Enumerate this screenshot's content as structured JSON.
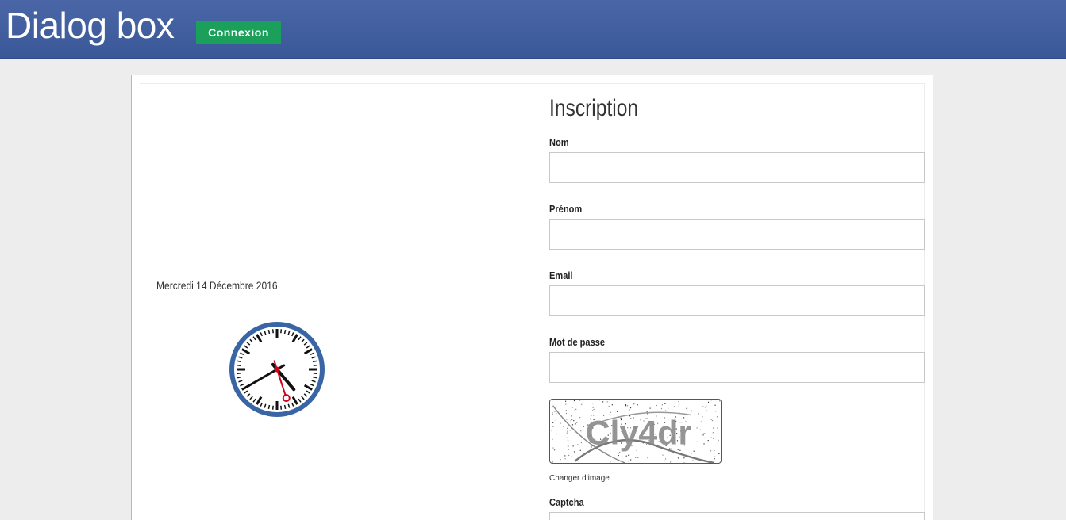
{
  "header": {
    "title": "Dialog box",
    "login_label": "Connexion",
    "bg_color": "#3a5898",
    "button_color": "#1aa05a"
  },
  "left_panel": {
    "date": "Mercredi 14 Décembre 2016",
    "clock": {
      "icon": "analog-clock-icon",
      "hours": 4,
      "minutes": 40,
      "seconds": 27,
      "ring_color": "#3a65a5"
    }
  },
  "form": {
    "title": "Inscription",
    "fields": [
      {
        "label": "Nom",
        "value": ""
      },
      {
        "label": "Prénom",
        "value": ""
      },
      {
        "label": "Email",
        "value": ""
      },
      {
        "label": "Mot de passe",
        "value": ""
      },
      {
        "label": "Captcha",
        "value": ""
      }
    ],
    "captcha_text": "Cly4dr",
    "change_image_label": "Changer d'image"
  }
}
